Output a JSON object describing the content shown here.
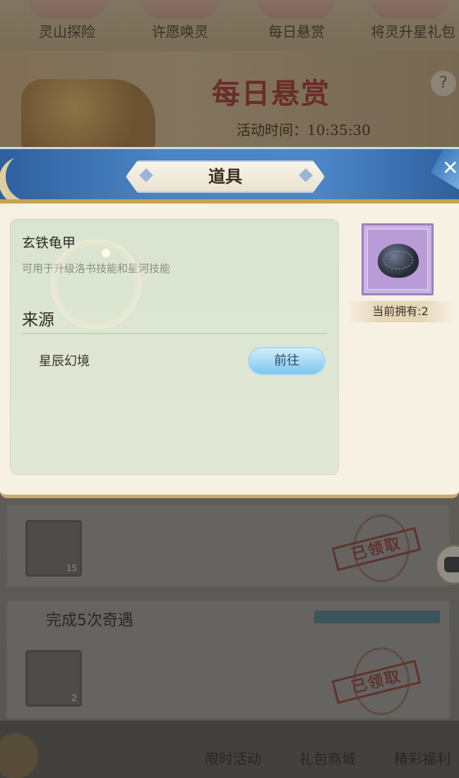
{
  "top_tabs": [
    "灵山探险",
    "许愿唤灵",
    "每日悬赏",
    "将灵升星礼包"
  ],
  "banner": {
    "title": "每日悬赏",
    "time_text": "活动时间：10:35:30",
    "help_icon": "question-icon"
  },
  "tasks": [
    {
      "name": "",
      "item_count": "15",
      "status": "已领取"
    },
    {
      "name": "完成5次奇遇",
      "item_count": "2",
      "status": "已领取",
      "progress": 1.0
    }
  ],
  "bottom_nav": [
    "限时活动",
    "礼包商城",
    "精彩福利"
  ],
  "dialog": {
    "title": "道具",
    "close_icon": "close-icon",
    "item_name": "玄铁龟甲",
    "item_desc": "可用于升级洛书技能和星河技能",
    "source_title": "来源",
    "sources": [
      {
        "name": "星辰幻境",
        "button": "前往"
      }
    ],
    "owned_text": "当前拥有:2",
    "item_icon": "turtle-shell-icon"
  },
  "colors": {
    "dialog_header": "#4a84c4",
    "panel_bg": "#dde6d3",
    "go_button": "#9fd6f3",
    "item_slot": "#cbb4e0",
    "stamp": "#8a3c36"
  }
}
